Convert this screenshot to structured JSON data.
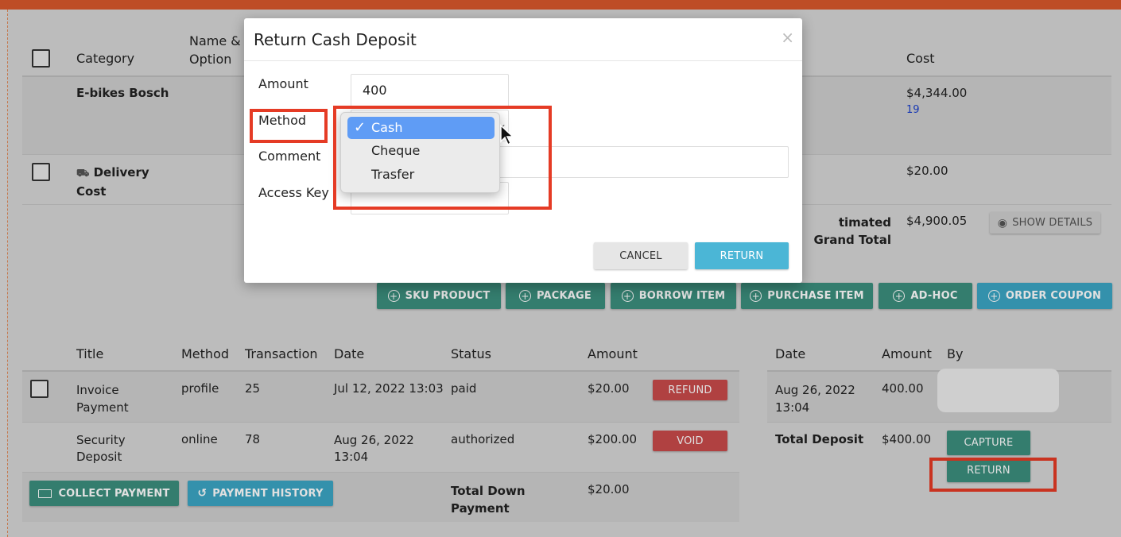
{
  "items_table": {
    "headers": {
      "category": "Category",
      "name_option": "Name & Option",
      "cost": "Cost"
    },
    "rows": [
      {
        "category": "E-bikes Bosch",
        "cost": "$4,344.00",
        "cost_link": "19"
      },
      {
        "category": "Delivery Cost",
        "cost": "$20.00"
      }
    ],
    "grand_total_label": "timated Grand Total",
    "grand_total_value": "$4,900.05",
    "show_details": "SHOW DETAILS"
  },
  "add_buttons": [
    "SKU PRODUCT",
    "PACKAGE",
    "BORROW ITEM",
    "PURCHASE ITEM",
    "AD-HOC",
    "ORDER COUPON"
  ],
  "payments_table": {
    "headers": {
      "title": "Title",
      "method": "Method",
      "transaction": "Transaction",
      "date": "Date",
      "status": "Status",
      "amount": "Amount"
    },
    "rows": [
      {
        "title": "Invoice Payment",
        "method": "profile",
        "transaction": "25",
        "date": "Jul 12, 2022 13:03",
        "status": "paid",
        "amount": "$20.00",
        "action": "REFUND"
      },
      {
        "title": "Security Deposit",
        "method": "online",
        "transaction": "78",
        "date": "Aug 26, 2022 13:04",
        "status": "authorized",
        "amount": "$200.00",
        "action": "VOID"
      }
    ],
    "collect_payment": "COLLECT PAYMENT",
    "payment_history": "PAYMENT HISTORY",
    "total_down_label": "Total Down Payment",
    "total_down_value": "$20.00"
  },
  "deposit_table": {
    "headers": {
      "date": "Date",
      "amount": "Amount",
      "by": "By"
    },
    "rows": [
      {
        "date": "Aug 26, 2022 13:04",
        "amount": "400.00"
      }
    ],
    "total_label": "Total Deposit",
    "total_value": "$400.00",
    "capture": "CAPTURE",
    "return": "RETURN"
  },
  "modal": {
    "title": "Return Cash Deposit",
    "close": "×",
    "labels": {
      "amount": "Amount",
      "method": "Method",
      "comment": "Comment",
      "access_key": "Access Key"
    },
    "amount_value": "400",
    "method_options": [
      "Cash",
      "Cheque",
      "Trasfer"
    ],
    "selected_method": "Cash",
    "cancel": "CANCEL",
    "return": "RETURN"
  },
  "colors": {
    "teal": "#3c8f7e",
    "cyan": "#3ca6c4",
    "red": "#c94b4b",
    "highlight": "#e53b25",
    "topbar": "#d9582c"
  }
}
